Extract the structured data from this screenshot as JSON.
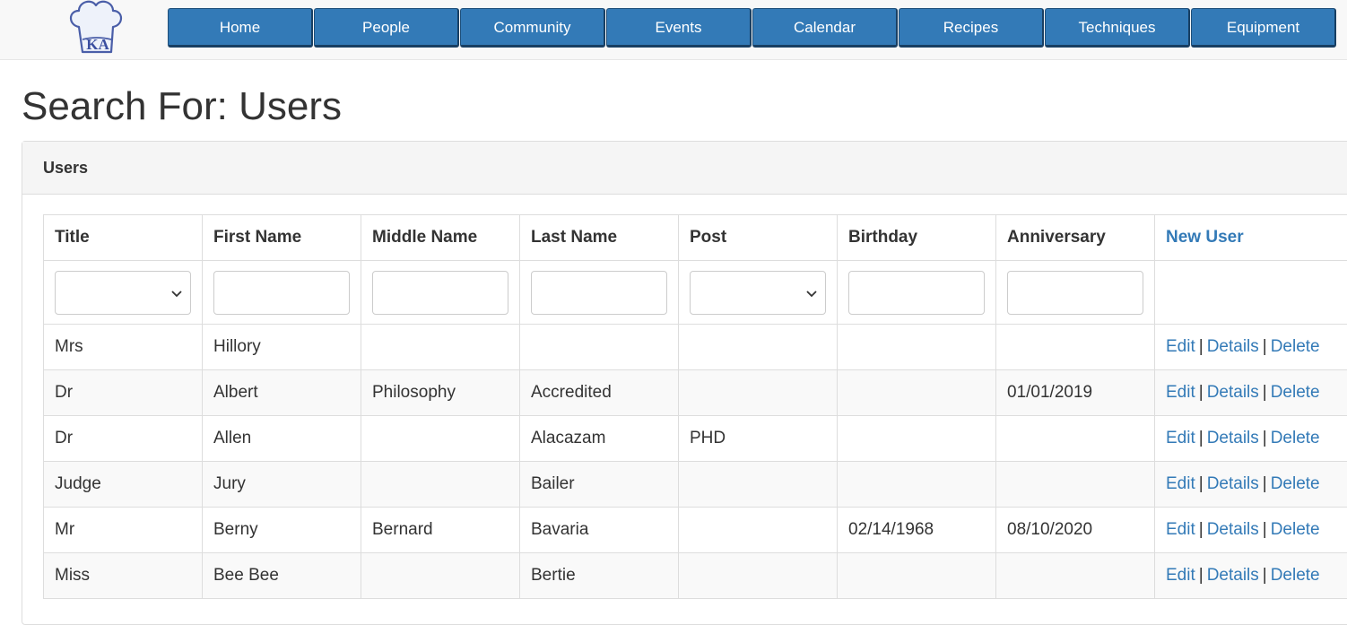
{
  "nav": {
    "logo_text": "KA",
    "items": [
      {
        "label": "Home"
      },
      {
        "label": "People"
      },
      {
        "label": "Community"
      },
      {
        "label": "Events"
      },
      {
        "label": "Calendar"
      },
      {
        "label": "Recipes"
      },
      {
        "label": "Techniques"
      },
      {
        "label": "Equipment"
      }
    ]
  },
  "page": {
    "title": "Search For: Users"
  },
  "panel": {
    "heading": "Users"
  },
  "table": {
    "headers": [
      "Title",
      "First Name",
      "Middle Name",
      "Last Name",
      "Post",
      "Birthday",
      "Anniversary"
    ],
    "new_user_label": "New User",
    "filters": {
      "title_select": "",
      "first_name": "",
      "middle_name": "",
      "last_name": "",
      "post_select": "",
      "birthday": "",
      "anniversary": ""
    },
    "actions": {
      "edit": "Edit",
      "details": "Details",
      "delete": "Delete",
      "separator": "|"
    },
    "rows": [
      {
        "title": "Mrs",
        "first": "Hillory",
        "middle": "",
        "last": "",
        "post": "",
        "birthday": "",
        "anniversary": ""
      },
      {
        "title": "Dr",
        "first": "Albert",
        "middle": "Philosophy",
        "last": "Accredited",
        "post": "",
        "birthday": "",
        "anniversary": "01/01/2019"
      },
      {
        "title": "Dr",
        "first": "Allen",
        "middle": "",
        "last": "Alacazam",
        "post": "PHD",
        "birthday": "",
        "anniversary": ""
      },
      {
        "title": "Judge",
        "first": "Jury",
        "middle": "",
        "last": "Bailer",
        "post": "",
        "birthday": "",
        "anniversary": ""
      },
      {
        "title": "Mr",
        "first": "Berny",
        "middle": "Bernard",
        "last": "Bavaria",
        "post": "",
        "birthday": "02/14/1968",
        "anniversary": "08/10/2020"
      },
      {
        "title": "Miss",
        "first": "Bee Bee",
        "middle": "",
        "last": "Bertie",
        "post": "",
        "birthday": "",
        "anniversary": ""
      }
    ]
  },
  "colors": {
    "nav_button": "#337ab7",
    "link": "#337ab7",
    "panel_heading_bg": "#f5f5f5",
    "striped_row": "#f9f9f9"
  }
}
